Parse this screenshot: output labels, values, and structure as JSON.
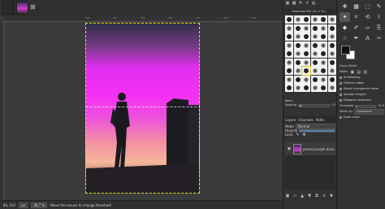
{
  "tabs": {
    "close_symbol": "⊠"
  },
  "ruler": {
    "ticks": [
      "100",
      "200",
      "300",
      "400",
      "500",
      "600",
      "700"
    ]
  },
  "status": {
    "coords": "84, 537",
    "unit": "px",
    "zoom": "36.7 %",
    "message": "Move the mouse to change threshold"
  },
  "brushes": {
    "title": "Hardness 025 (51 × 51)",
    "basic_label": "Basic,",
    "spacing_label": "Spacing",
    "spacing_value": 10
  },
  "layers": {
    "tabs": [
      "Layers",
      "Channels",
      "Paths"
    ],
    "mode_label": "Mode",
    "mode_value": "Normal",
    "opacity_label": "Opacity",
    "lock_label": "Lock:",
    "layer_name": "pexels-joseph-davis"
  },
  "tool_options": {
    "title": "Fuzzy Select",
    "mode_label": "Mode:",
    "antialiasing": "Antialiasing",
    "feather_edges": "Feather edges",
    "select_transparent": "Select transparent areas",
    "sample_merged": "Sample merged",
    "diagonal_neighbors": "Diagonal neighbors",
    "threshold_label": "Threshold",
    "threshold_value": "15.0",
    "select_by_label": "Select by",
    "select_by_value": "Composite",
    "draw_mask": "Draw mask"
  },
  "colors": {
    "fg": "#111111",
    "bg": "#ffffff",
    "accent": "#e8e800"
  }
}
